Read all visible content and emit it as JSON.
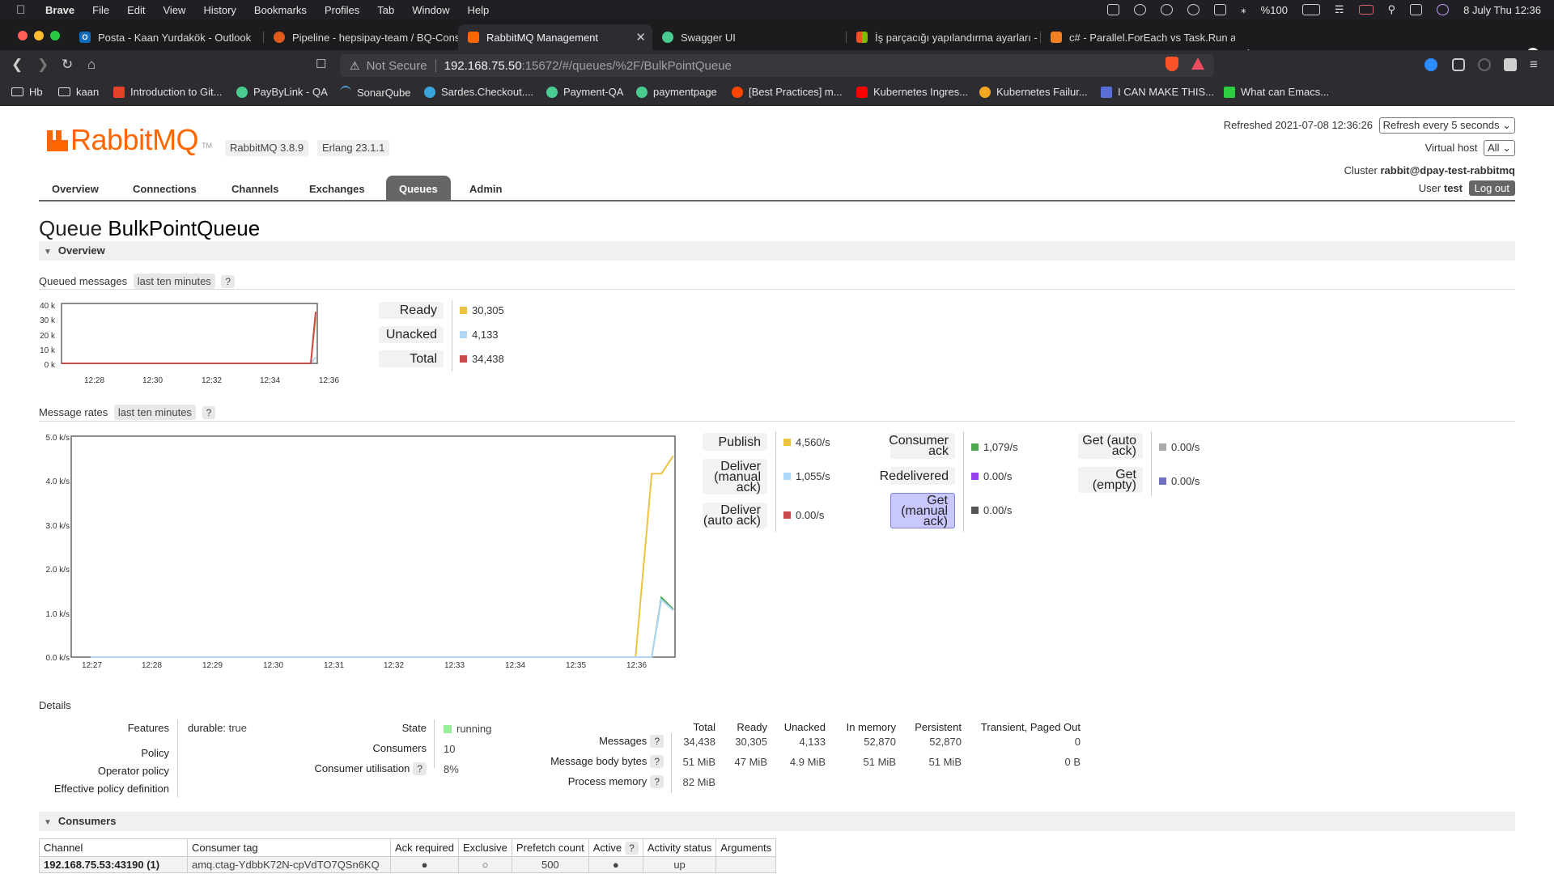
{
  "menubar": {
    "app": "Brave",
    "items": [
      "File",
      "Edit",
      "View",
      "History",
      "Bookmarks",
      "Profiles",
      "Tab",
      "Window",
      "Help"
    ],
    "battery": "%100",
    "datetime": "8 July Thu  12:36"
  },
  "tabs": [
    {
      "title": "Posta - Kaan Yurdakök - Outlook",
      "icon": "outlook-icon",
      "color": "#0f6cbd"
    },
    {
      "title": "Pipeline - hepsipay-team / BQ-Cons",
      "icon": "pipeline-icon",
      "color": "#e05a1c"
    },
    {
      "title": "RabbitMQ Management",
      "icon": "rabbitmq-icon",
      "color": "#ff6600"
    },
    {
      "title": "Swagger UI",
      "icon": "swagger-icon",
      "color": "#49cc90"
    },
    {
      "title": "İş parçacığı yapılandırma ayarları -",
      "icon": "microsoft-icon",
      "color": "#f25022"
    },
    {
      "title": "c# - Parallel.ForEach vs Task.Run ar",
      "icon": "stackoverflow-icon",
      "color": "#f48024"
    }
  ],
  "address": {
    "security": "Not Secure",
    "host": "192.168.75.50",
    "path": ":15672/#/queues/%2F/BulkPointQueue"
  },
  "bookmarks": [
    {
      "label": "Hb",
      "icon": "folder-icon"
    },
    {
      "label": "kaan",
      "icon": "folder-icon"
    },
    {
      "label": "Introduction to Git...",
      "icon": "gitlab-icon",
      "color": "#e24329"
    },
    {
      "label": "PayByLink - QA",
      "icon": "swagger-icon",
      "color": "#49cc90"
    },
    {
      "label": "SonarQube",
      "icon": "sonarqube-icon",
      "color": "#4e9bcd"
    },
    {
      "label": "Sardes.Checkout....",
      "icon": "globe-icon",
      "color": "#39a5dc"
    },
    {
      "label": "Payment-QA",
      "icon": "swagger-icon",
      "color": "#49cc90"
    },
    {
      "label": "paymentpage",
      "icon": "swagger-icon",
      "color": "#49cc90"
    },
    {
      "label": "[Best Practices] m...",
      "icon": "reddit-icon",
      "color": "#ff4500"
    },
    {
      "label": "Kubernetes Ingres...",
      "icon": "youtube-icon",
      "color": "#ff0000"
    },
    {
      "label": "Kubernetes Failur...",
      "icon": "medium-icon",
      "color": "#f5a623"
    },
    {
      "label": "I CAN MAKE THIS...",
      "icon": "image-icon",
      "color": "#5a6fd6"
    },
    {
      "label": "What can Emacs...",
      "icon": "emacs-icon",
      "color": "#2ecc40"
    }
  ],
  "header": {
    "logo": "RabbitMQ",
    "version": "RabbitMQ 3.8.9",
    "erlang": "Erlang 23.1.1",
    "refreshed_label": "Refreshed",
    "refreshed_at": "2021-07-08 12:36:26",
    "refresh_option": "Refresh every 5 seconds",
    "vhost_label": "Virtual host",
    "vhost_value": "All",
    "cluster_label": "Cluster",
    "cluster_value": "rabbit@dpay-test-rabbitmq",
    "user_label": "User",
    "user_value": "test",
    "logout": "Log out"
  },
  "nav": [
    "Overview",
    "Connections",
    "Channels",
    "Exchanges",
    "Queues",
    "Admin"
  ],
  "queue": {
    "prefix": "Queue",
    "name": "BulkPointQueue"
  },
  "sections": {
    "overview": "Overview",
    "consumers": "Consumers",
    "details": "Details"
  },
  "queued": {
    "label": "Queued messages",
    "range": "last ten minutes",
    "help": "?",
    "yticks": [
      "40 k",
      "30 k",
      "20 k",
      "10 k",
      "0 k"
    ],
    "xticks": [
      "12:28",
      "12:30",
      "12:32",
      "12:34",
      "12:36"
    ],
    "legend": [
      {
        "label": "Ready",
        "value": "30,305",
        "color": "#edc240"
      },
      {
        "label": "Unacked",
        "value": "4,133",
        "color": "#afd8f8"
      },
      {
        "label": "Total",
        "value": "34,438",
        "color": "#cb4b4b"
      }
    ]
  },
  "rates": {
    "label": "Message rates",
    "range": "last ten minutes",
    "help": "?",
    "yticks": [
      "5.0 k/s",
      "4.0 k/s",
      "3.0 k/s",
      "2.0 k/s",
      "1.0 k/s",
      "0.0 k/s"
    ],
    "xticks": [
      "12:27",
      "12:28",
      "12:29",
      "12:30",
      "12:31",
      "12:32",
      "12:33",
      "12:34",
      "12:35",
      "12:36"
    ],
    "legend_col1": [
      {
        "label": "Publish",
        "value": "4,560/s",
        "color": "#edc240"
      },
      {
        "label": "Deliver (manual ack)",
        "value": "1,055/s",
        "color": "#afd8f8"
      },
      {
        "label": "Deliver (auto ack)",
        "value": "0.00/s",
        "color": "#cb4b4b"
      }
    ],
    "legend_col2": [
      {
        "label": "Consumer ack",
        "value": "1,079/s",
        "color": "#4da74d"
      },
      {
        "label": "Redelivered",
        "value": "0.00/s",
        "color": "#9440ed"
      },
      {
        "label": "Get (manual ack)",
        "value": "0.00/s",
        "color": "#555555"
      }
    ],
    "legend_col3": [
      {
        "label": "Get (auto ack)",
        "value": "0.00/s",
        "color": "#aaaaaa"
      },
      {
        "label": "Get (empty)",
        "value": "0.00/s",
        "color": "#7070c0"
      }
    ]
  },
  "details": {
    "features_label": "Features",
    "features_key": "durable:",
    "features_value": "true",
    "policy_label": "Policy",
    "operator_policy_label": "Operator policy",
    "effective_policy_label": "Effective policy definition",
    "state_label": "State",
    "state_value": "running",
    "consumers_label": "Consumers",
    "consumers_value": "10",
    "utilisation_label": "Consumer utilisation",
    "utilisation_value": "8%",
    "help": "?",
    "columns": [
      "Total",
      "Ready",
      "Unacked",
      "In memory",
      "Persistent",
      "Transient, Paged Out"
    ],
    "rows": [
      {
        "label": "Messages",
        "values": [
          "34,438",
          "30,305",
          "4,133",
          "52,870",
          "52,870",
          "0"
        ]
      },
      {
        "label": "Message body bytes",
        "values": [
          "51 MiB",
          "47 MiB",
          "4.9 MiB",
          "51 MiB",
          "51 MiB",
          "0 B"
        ]
      },
      {
        "label": "Process memory",
        "values": [
          "82 MiB"
        ]
      }
    ]
  },
  "consumers_table": {
    "headers": [
      "Channel",
      "Consumer tag",
      "Ack required",
      "Exclusive",
      "Prefetch count",
      "Active",
      "Activity status",
      "Arguments"
    ],
    "active_help": "?",
    "row": [
      "192.168.75.53:43190 (1)",
      "amq.ctag-YdbbK72N-cpVdTO7QSn6KQ",
      "●",
      "○",
      "500",
      "●",
      "up",
      ""
    ]
  },
  "chart_data": [
    {
      "type": "line",
      "title": "Queued messages",
      "x": [
        "12:28",
        "12:29",
        "12:30",
        "12:31",
        "12:32",
        "12:33",
        "12:34",
        "12:35",
        "12:36",
        "12:36:26"
      ],
      "series": [
        {
          "name": "Ready",
          "values": [
            0,
            0,
            0,
            0,
            0,
            0,
            0,
            0,
            0,
            30305
          ]
        },
        {
          "name": "Unacked",
          "values": [
            0,
            0,
            0,
            0,
            0,
            0,
            0,
            0,
            0,
            4133
          ]
        },
        {
          "name": "Total",
          "values": [
            0,
            0,
            0,
            0,
            0,
            0,
            0,
            0,
            0,
            34438
          ]
        }
      ],
      "ylim": [
        0,
        40000
      ],
      "colors": [
        "#edc240",
        "#afd8f8",
        "#cb4b4b"
      ]
    },
    {
      "type": "line",
      "title": "Message rates",
      "x": [
        "12:27",
        "12:28",
        "12:29",
        "12:30",
        "12:31",
        "12:32",
        "12:33",
        "12:34",
        "12:35",
        "12:36",
        "12:36:05",
        "12:36:15",
        "12:36:25"
      ],
      "series": [
        {
          "name": "Publish",
          "values": [
            0,
            0,
            0,
            0,
            0,
            0,
            0,
            0,
            0,
            0,
            4150,
            4150,
            4560
          ]
        },
        {
          "name": "Consumer ack",
          "values": [
            0,
            0,
            0,
            0,
            0,
            0,
            0,
            0,
            0,
            0,
            0,
            1350,
            1079
          ]
        },
        {
          "name": "Deliver (manual ack)",
          "values": [
            0,
            0,
            0,
            0,
            0,
            0,
            0,
            0,
            0,
            0,
            0,
            1300,
            1055
          ]
        }
      ],
      "ylim": [
        0,
        5000
      ],
      "colors": [
        "#edc240",
        "#4da74d",
        "#afd8f8"
      ]
    }
  ]
}
